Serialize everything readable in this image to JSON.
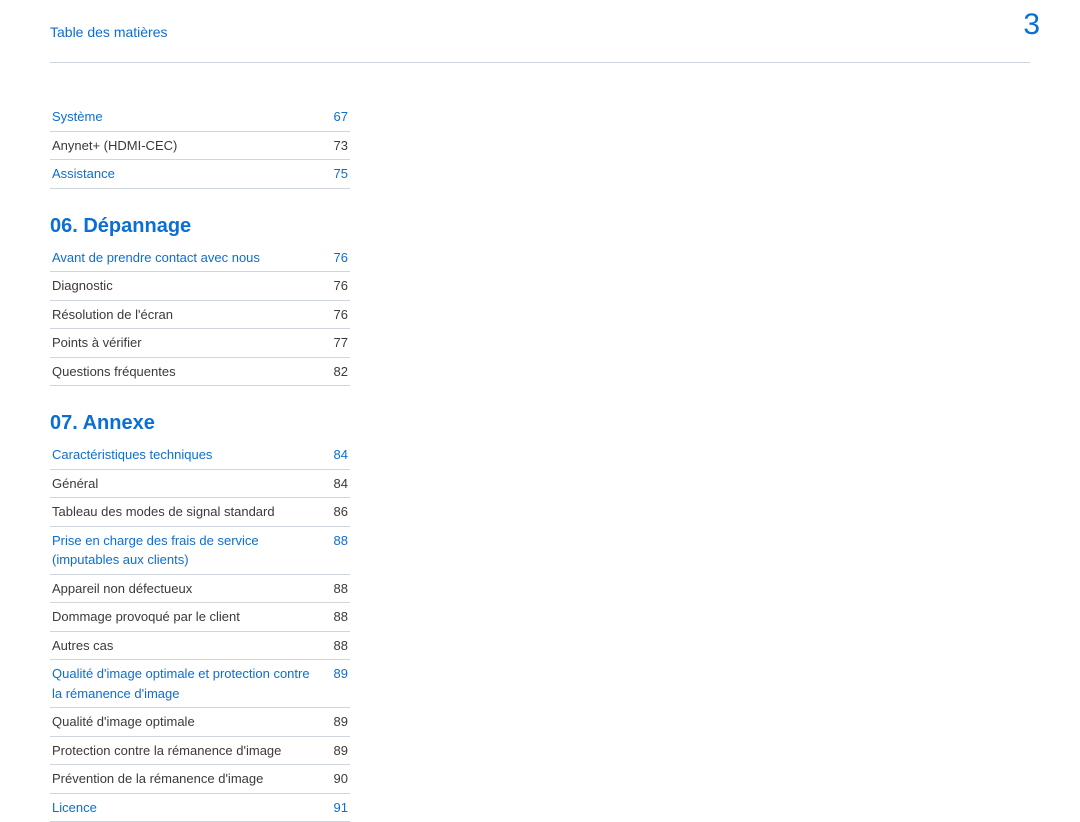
{
  "header": {
    "title": "Table des matières",
    "page_number": "3"
  },
  "section_pre_items": [
    {
      "label": "Système",
      "page": "67",
      "link": true
    },
    {
      "label": "Anynet+ (HDMI-CEC)",
      "page": "73",
      "link": false
    },
    {
      "label": "Assistance",
      "page": "75",
      "link": true
    }
  ],
  "section06": {
    "title": "06. Dépannage",
    "items": [
      {
        "label": "Avant de prendre contact avec nous",
        "page": "76",
        "link": true
      },
      {
        "label": "Diagnostic",
        "page": "76",
        "link": false
      },
      {
        "label": "Résolution de l'écran",
        "page": "76",
        "link": false
      },
      {
        "label": "Points à vérifier",
        "page": "77",
        "link": false
      },
      {
        "label": "Questions fréquentes",
        "page": "82",
        "link": false
      }
    ]
  },
  "section07": {
    "title": "07.  Annexe",
    "items": [
      {
        "label": "Caractéristiques techniques",
        "page": "84",
        "link": true
      },
      {
        "label": "Général",
        "page": "84",
        "link": false
      },
      {
        "label": "Tableau des modes de signal standard",
        "page": "86",
        "link": false
      },
      {
        "label": "Prise en charge des frais de service (imputables aux clients)",
        "page": "88",
        "link": true
      },
      {
        "label": "Appareil non défectueux",
        "page": "88",
        "link": false
      },
      {
        "label": "Dommage provoqué par le client",
        "page": "88",
        "link": false
      },
      {
        "label": "Autres cas",
        "page": "88",
        "link": false
      },
      {
        "label": "Qualité d'image optimale et protection contre la rémanence d'image",
        "page": "89",
        "link": true
      },
      {
        "label": "Qualité d'image optimale",
        "page": "89",
        "link": false
      },
      {
        "label": "Protection contre la rémanence d'image",
        "page": "89",
        "link": false
      },
      {
        "label": "Prévention de la rémanence d'image",
        "page": "90",
        "link": false
      },
      {
        "label": "Licence",
        "page": "91",
        "link": true
      }
    ]
  }
}
